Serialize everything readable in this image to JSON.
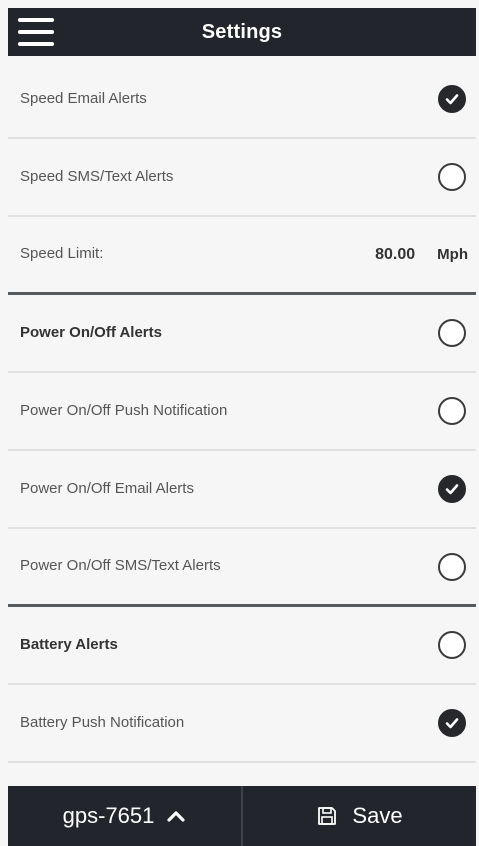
{
  "header": {
    "title": "Settings"
  },
  "rows": [
    {
      "label": "Speed Email Alerts",
      "checked": true
    },
    {
      "label": "Speed SMS/Text Alerts",
      "checked": false
    },
    {
      "label": "Speed Limit:",
      "value": "80.00",
      "unit": "Mph"
    },
    {
      "label": "Power On/Off Alerts",
      "checked": false
    },
    {
      "label": "Power On/Off Push Notification",
      "checked": false
    },
    {
      "label": "Power On/Off Email Alerts",
      "checked": true
    },
    {
      "label": "Power On/Off SMS/Text Alerts",
      "checked": false
    },
    {
      "label": "Battery Alerts",
      "checked": false
    },
    {
      "label": "Battery Push Notification",
      "checked": true
    }
  ],
  "footer": {
    "device_label": "gps-7651",
    "save_label": "Save"
  },
  "colors": {
    "dark_bar": "#22252b",
    "background": "#f6f6f6",
    "divider": "#e0e0e0",
    "section_divider": "#555a5e"
  },
  "icons": {
    "menu": "hamburger-menu-icon",
    "checked": "check-circle-icon",
    "unchecked": "empty-circle-icon",
    "chevron": "chevron-up-icon",
    "save": "floppy-disk-icon"
  }
}
